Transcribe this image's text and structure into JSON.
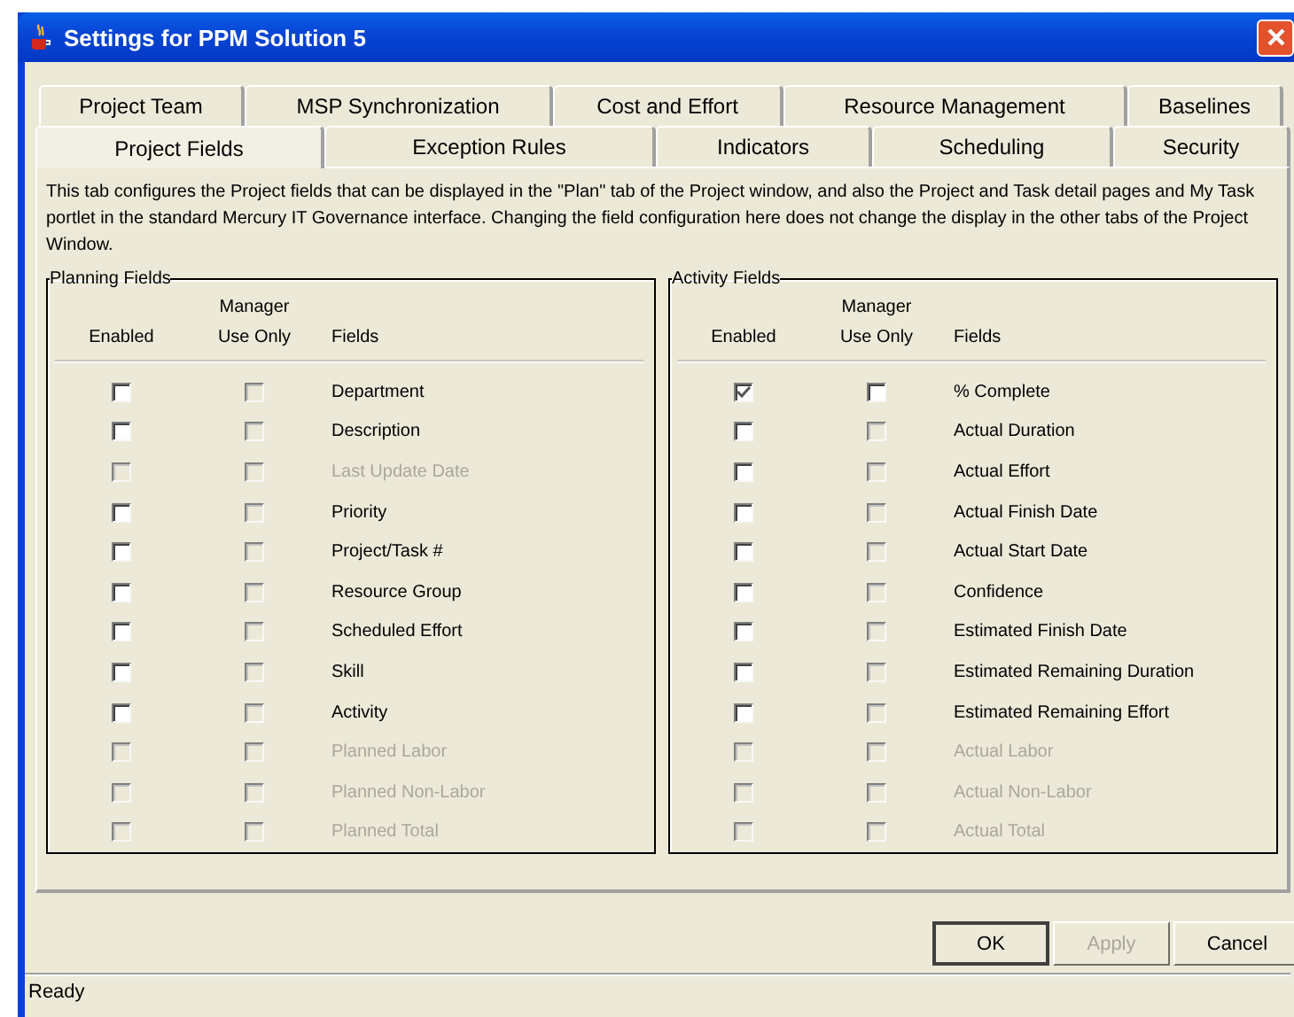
{
  "window": {
    "title": "Settings for PPM Solution 5"
  },
  "tab_rows": [
    [
      {
        "label": "Project Team",
        "selected": false
      },
      {
        "label": "MSP Synchronization",
        "selected": false
      },
      {
        "label": "Cost and Effort",
        "selected": false
      },
      {
        "label": "Resource Management",
        "selected": false
      },
      {
        "label": "Baselines",
        "selected": false
      }
    ],
    [
      {
        "label": "Project Fields",
        "selected": true
      },
      {
        "label": "Exception Rules",
        "selected": false
      },
      {
        "label": "Indicators",
        "selected": false
      },
      {
        "label": "Scheduling",
        "selected": false
      },
      {
        "label": "Security",
        "selected": false
      }
    ]
  ],
  "description": "This tab configures the Project fields that can be displayed in the \"Plan\" tab of the Project window, and also the Project and Task detail pages and My Task portlet in the standard Mercury IT Governance interface. Changing the field configuration here does not change the display in the other tabs of the Project Window.",
  "groups": [
    {
      "title": "Planning Fields",
      "columns": [
        "Enabled",
        "Manager\nUse Only",
        "Fields"
      ],
      "rows": [
        {
          "field": "Department",
          "disabled": false,
          "enabled": false,
          "manager_use_only": false,
          "manager_disabled": true
        },
        {
          "field": "Description",
          "disabled": false,
          "enabled": false,
          "manager_use_only": false,
          "manager_disabled": true
        },
        {
          "field": "Last Update Date",
          "disabled": true,
          "enabled": false,
          "manager_use_only": false,
          "manager_disabled": true
        },
        {
          "field": "Priority",
          "disabled": false,
          "enabled": false,
          "manager_use_only": false,
          "manager_disabled": true
        },
        {
          "field": "Project/Task #",
          "disabled": false,
          "enabled": false,
          "manager_use_only": false,
          "manager_disabled": true
        },
        {
          "field": "Resource Group",
          "disabled": false,
          "enabled": false,
          "manager_use_only": false,
          "manager_disabled": true
        },
        {
          "field": "Scheduled Effort",
          "disabled": false,
          "enabled": false,
          "manager_use_only": false,
          "manager_disabled": true
        },
        {
          "field": "Skill",
          "disabled": false,
          "enabled": false,
          "manager_use_only": false,
          "manager_disabled": true
        },
        {
          "field": "Activity",
          "disabled": false,
          "enabled": false,
          "manager_use_only": false,
          "manager_disabled": true
        },
        {
          "field": "Planned Labor",
          "disabled": true,
          "enabled": false,
          "manager_use_only": false,
          "manager_disabled": true
        },
        {
          "field": "Planned Non-Labor",
          "disabled": true,
          "enabled": false,
          "manager_use_only": false,
          "manager_disabled": true
        },
        {
          "field": "Planned Total",
          "disabled": true,
          "enabled": false,
          "manager_use_only": false,
          "manager_disabled": true
        }
      ]
    },
    {
      "title": "Activity Fields",
      "columns": [
        "Enabled",
        "Manager\nUse Only",
        "Fields"
      ],
      "rows": [
        {
          "field": "% Complete",
          "disabled": false,
          "enabled": true,
          "manager_use_only": false,
          "manager_disabled": false
        },
        {
          "field": "Actual Duration",
          "disabled": false,
          "enabled": false,
          "manager_use_only": false,
          "manager_disabled": true
        },
        {
          "field": "Actual Effort",
          "disabled": false,
          "enabled": false,
          "manager_use_only": false,
          "manager_disabled": true
        },
        {
          "field": "Actual Finish Date",
          "disabled": false,
          "enabled": false,
          "manager_use_only": false,
          "manager_disabled": true
        },
        {
          "field": "Actual Start Date",
          "disabled": false,
          "enabled": false,
          "manager_use_only": false,
          "manager_disabled": true
        },
        {
          "field": "Confidence",
          "disabled": false,
          "enabled": false,
          "manager_use_only": false,
          "manager_disabled": true
        },
        {
          "field": "Estimated Finish Date",
          "disabled": false,
          "enabled": false,
          "manager_use_only": false,
          "manager_disabled": true
        },
        {
          "field": "Estimated Remaining Duration",
          "disabled": false,
          "enabled": false,
          "manager_use_only": false,
          "manager_disabled": true
        },
        {
          "field": "Estimated Remaining Effort",
          "disabled": false,
          "enabled": false,
          "manager_use_only": false,
          "manager_disabled": true
        },
        {
          "field": "Actual Labor",
          "disabled": true,
          "enabled": false,
          "manager_use_only": false,
          "manager_disabled": true
        },
        {
          "field": "Actual Non-Labor",
          "disabled": true,
          "enabled": false,
          "manager_use_only": false,
          "manager_disabled": true
        },
        {
          "field": "Actual Total",
          "disabled": true,
          "enabled": false,
          "manager_use_only": false,
          "manager_disabled": true
        }
      ]
    }
  ],
  "buttons": [
    {
      "label": "OK",
      "disabled": false,
      "default": true
    },
    {
      "label": "Apply",
      "disabled": true,
      "default": false
    },
    {
      "label": "Cancel",
      "disabled": false,
      "default": false
    }
  ],
  "status_bar": "Ready"
}
